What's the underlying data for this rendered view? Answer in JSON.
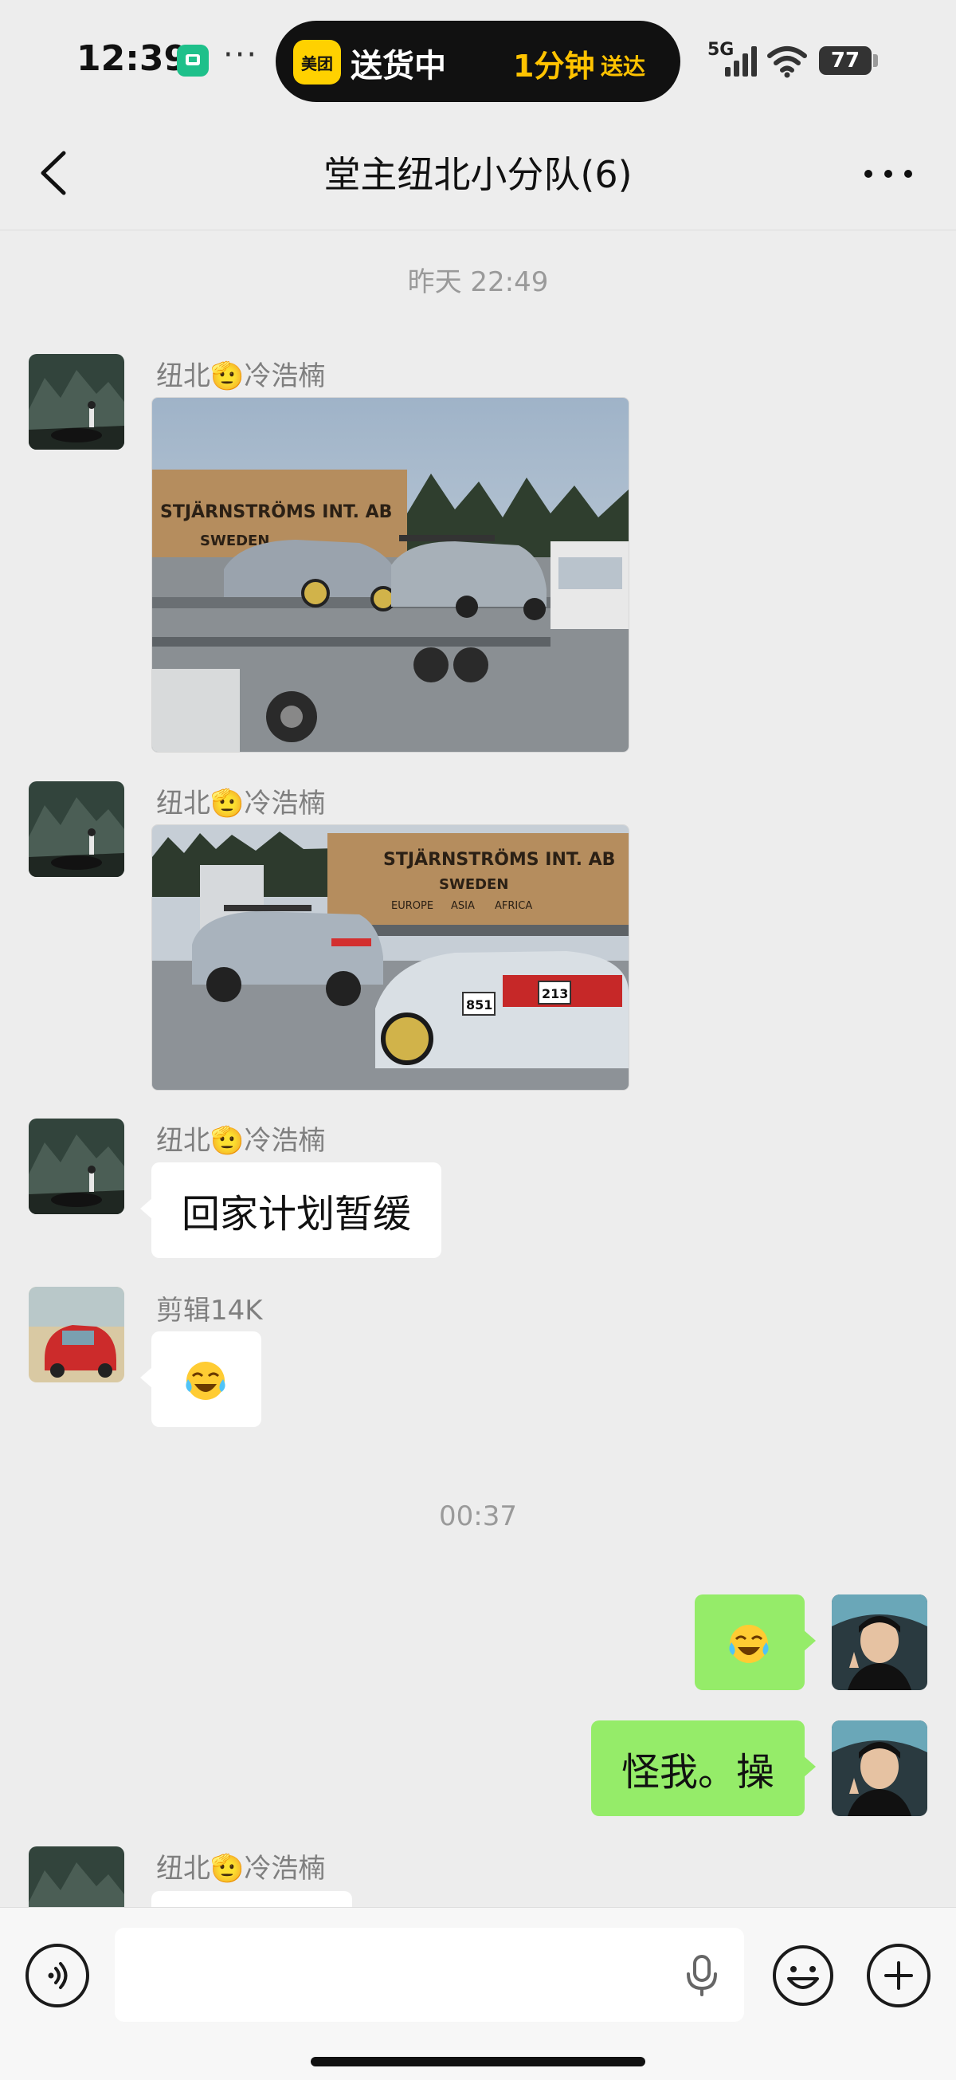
{
  "status_bar": {
    "time": "12:39",
    "more": "···",
    "island_logo": "美团",
    "island_status": "送货中",
    "island_eta": "1分钟",
    "island_eta_suffix": "送达",
    "network": "5G",
    "battery": "77",
    "battery_level": 0.77
  },
  "header": {
    "title": "堂主纽北小分队(6)"
  },
  "messages": {
    "sep1": "昨天 22:49",
    "m1_sender": "纽北🫡冷浩楠",
    "m2_sender": "纽北🫡冷浩楠",
    "m3_sender": "纽北🫡冷浩楠",
    "m3_text": "回家计划暂缓",
    "m4_sender": "剪辑14K",
    "sep2": "00:37",
    "m6_text": "怪我。操",
    "m7_sender": "纽北🫡冷浩楠",
    "photo1_texts": [
      "STJÄRNSTRÖMS INT. AB",
      "SWEDEN"
    ],
    "photo2_texts": [
      "STJÄRNSTRÖMS INT. AB",
      "SWEDEN",
      "EUROPE",
      "ASIA",
      "AFRICA",
      "851",
      "213"
    ]
  },
  "icons": {
    "back": "chevron-left-icon",
    "more": "more-icon",
    "voice": "voice-icon",
    "mic": "mic-icon",
    "emoji": "emoji-icon",
    "plus": "plus-icon",
    "laugh_cry": "laugh-cry-emoji"
  },
  "colors": {
    "background": "#ededed",
    "outgoing_bubble": "#95ec69",
    "incoming_bubble": "#ffffff",
    "island": "#111111",
    "island_accent": "#ffc300",
    "meituan": "#ffd100"
  }
}
